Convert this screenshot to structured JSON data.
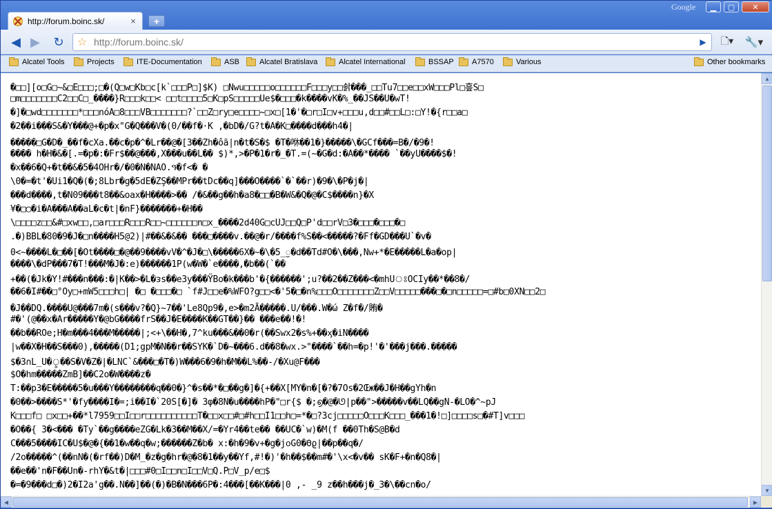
{
  "window": {
    "brand": "Google",
    "min_glyph": "▁",
    "max_glyph": "▢",
    "close_glyph": "✕"
  },
  "tab": {
    "title": "http://forum.boinc.sk/",
    "close_glyph": "×"
  },
  "new_tab_glyph": "+",
  "toolbar": {
    "back_glyph": "◀",
    "forward_glyph": "▶",
    "reload_glyph": "↻",
    "star_glyph": "☆",
    "url": "http://forum.boinc.sk/",
    "go_glyph": "▶",
    "page_menu_glyph": "🗋▾",
    "wrench_menu_glyph": "🔧▾"
  },
  "bookmarks": [
    {
      "label": "Alcatel Tools"
    },
    {
      "label": "Projects"
    },
    {
      "label": "ITE-Documentation"
    },
    {
      "label": "ASB"
    },
    {
      "label": "Alcatel Bratislava"
    },
    {
      "label": "Alcatel International"
    },
    {
      "label": "BSSAP"
    },
    {
      "label": "A7570"
    },
    {
      "label": "Various"
    }
  ],
  "other_bookmarks": "Other bookmarks",
  "content_lines": [
    "�□□][o□G□~&□E□□□;□�(Q□w□Kb□c[k`□□□P□]$K) □Nwu□□□□□o□□□□□□F□□□y□□솱���_□□Tu7□□e□□xW□□□Pl□흪S□",
    "□m□□□□□□□C2□□C□_����}R□□□k□□< □□t□□□□5□K□pS□□□□□Ue$�□□□�k����vK�%_��JS��U�wT!",
    "�]�□wd□□□□□□□*□□□nóA□8□□□VB□□□□□□□?`□□Z□ry□e□□□□~□x□[1�'�□r□I□v+□□□u,d□□#□□L□:□Y!�{r□□a□",
    "�2��i���S&�Y���@+�p�x\"G�Q���V�(0/��f�·K ,�bD�/G?t�A�K□����d���h4�|",
    "�����□G�D�_��f�cXa.��c�p�^�Lr��@�[3��Zh�ôã|n�t�S�$ �T�咻��1�}�����\\�GCf���=B�/�9�!",
    "���� h�H�&�[.=�p�:�Fr$��@���,X���u��L�� $)*,>�P�1�r�_�T.=(~�G�d:�Ă��*���� `��yU����$�!",
    "�x��6�Q+�t��&�5�4OHr�/�0�N�NĀÕ.ዓ�f<� �",
    "\\0�=�t'�Ui1�Q�(�;8Lbr�g�5dE�ZŞ��MPr��tDc��q]���O����`�`��r)�9�\\�P�j�|",
    "���d����,t�N09���t8��&oax�H����>�� /�&��g��h�a8�□□�B�W&�Q�@�C$����n}�X",
    "¥�□◯�i�A���A��aL�c�t|�nF}�������+�H��",
    "\\□□□□z□□&#□xw□□,□ar□□□R□□□R□□~□□□□□□n□x_����2d40G□cUJ□□Q□P'd□□rV□3�□□□�□□□�□",
    ".�)BBL�80�9�J�□n����H5@2)|#��&�&�� ���□����v.��@�r/����f%S��<�����?�Ff�GD���U`�v�",
    "0<~����L�□��[�Ot����□�@��9����vV�^�J�□\\�����6X�~�\\�5_ॖ�d��Td#O�\\���,Nw+*�E�����L�a�op|",
    "����\\�dP���7�T!���M�J�:e)������1P(w�W�`e����,ֿ�b��(`��",
    "+��(�Jk�Y!#���n���:�|K��>�L�ᴈs��e3y���ŸBo�k���b'�{������';u?��2��Z���<�mhUঃOCIy��*��8�/",
    "��6�I#��□°Oy□+mW5□□□h□| �□ �□□□�□ `f#J□□e�%WFO?g□□<�'5�□�n%□□□O□□□□□□□Z□□V□□□□□���□�□n□□□□□=□#b□0XN□□2□",
    "�J��DQ.����U@���7m�(s���v?�Q}~7��'Le8Qp9�,e>�m2Ā�����.U/���.W�ώ Z�f�/賄�",
    "#�'(@��x�Ar�����Y�@bG����frS��J�E����K��GT��}�� ���e��!�!",
    "��b��ROe;H�m���4���M�����|;<+\\��H�,7^ku���&��0�r(��Swx2�s%+��ӽ�iN����",
    "|w��X�H��S���0),�����(D1;gpM�N��r��SYK�`D�~���6.d��8�wx.>\"����`��h=�p!'�'���j���.�����",
    "$�3∩L_U�ৢ��S�V�Z�|�LNC`&���□�T�)W���6�9�h�M��L%��-/�Xu@F���",
    "$O�hm�����ZmB]��C2o�W����z�",
    "T:��p3�E�����5�u���Y��������q��0�}^�s��*�□��g�]�{+��X[MŸ�n�[�?�7Os�2Œж��J�H��gYh�n",
    "�0��>����S*'�fy����I�=;i��I�`20Ŝ[�]� 3φ�8N�u����hP�\"□r{$ �;൭�@�ᘎ|p��\">�����v��LQ��gN-�LO�^~pJ",
    "K□□□f□ □x□□+��*l7959□□I□□r□□□□□□□□□□T�□□x□□#□#h□□I1□□h□=*�□?3cj□□□□□O□□□K□□□_���1�!□]□□□□s□�#T]v□□□",
    "�O��{ 3�<��� �Ty`��g����eZG�Lk�3��M��X/=�Yr4��te��  ��UC�`w)�M(f ��0Th�S@B�d",
    "C���5����IC�U$�@�{��1�w��q�w;������Z�b� x:�h�9�v+�g�jᴏG0�Θϱ|��p��q�/",
    "/2o�����^(��nN�(�rf��)D�M_�z�g�hr�@�8�1��y��Yf,#!�)'�h��$��m#�'\\x<�v�� sK�F+�n�Q8�|",
    "��e��'n�F��Un�-rhY�&t�|□□□#0□I□□n□I□□V□Q.P□V_p/e□$",
    "�=�9���d□�)2�I2a'g��.N��]��(�)�B�N���6P�:4���[��K���|0 ,- _9 z��h���j�_3�\\��cn�o/"
  ]
}
